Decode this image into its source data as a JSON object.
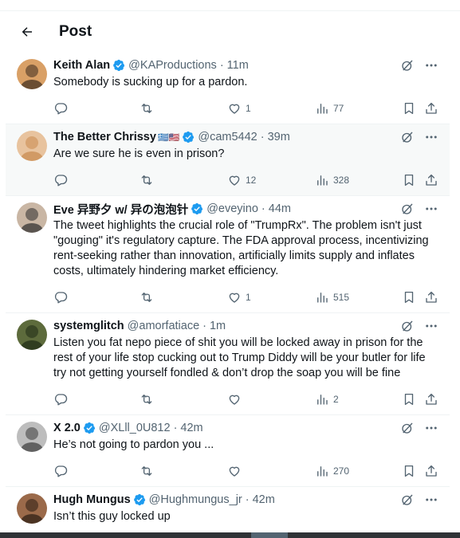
{
  "header": {
    "title": "Post"
  },
  "colors": {
    "verified": "#1d9bf0",
    "text": "#0f1419",
    "muted": "#536471",
    "divider": "#eff3f4"
  },
  "posts": [
    {
      "name": "Keith Alan",
      "verified": true,
      "flags": "",
      "handle": "@KAProductions",
      "time": "11m",
      "text": "Somebody is sucking up for a pardon.",
      "replies": "",
      "reposts": "",
      "likes": "1",
      "views": "77",
      "highlight": false
    },
    {
      "name": "The Better Chrissy",
      "verified": true,
      "flags": "🇬🇷🇺🇸",
      "handle": "@cam5442",
      "time": "39m",
      "text": "Are we sure he is even in prison?",
      "replies": "",
      "reposts": "",
      "likes": "12",
      "views": "328",
      "highlight": true
    },
    {
      "name": "Eve 异野夕 w/ 异の泡泡针",
      "verified": true,
      "flags": "",
      "handle": "@eveyino",
      "time": "44m",
      "text": "The tweet highlights the crucial role of \"TrumpRx\". The problem isn't just \"gouging\" it's regulatory capture. The FDA approval process, incentivizing rent-seeking rather than innovation, artificially limits supply and inflates costs, ultimately hindering market efficiency.",
      "replies": "",
      "reposts": "",
      "likes": "1",
      "views": "515",
      "highlight": false
    },
    {
      "name": "systemglitch",
      "verified": false,
      "flags": "",
      "handle": "@amorfatiace",
      "time": "1m",
      "text": "Listen you fat nepo piece of shit you will be locked away in prison for the rest of your life stop cucking out to Trump Diddy will be your butler for life try not getting yourself fondled & don’t drop the soap you will be fine",
      "replies": "",
      "reposts": "",
      "likes": "",
      "views": "2",
      "highlight": false
    },
    {
      "name": "X 2.0",
      "verified": true,
      "flags": "",
      "handle": "@XLll_0U812",
      "time": "42m",
      "text": "He’s not going to pardon you ...",
      "replies": "",
      "reposts": "",
      "likes": "",
      "views": "270",
      "highlight": false
    },
    {
      "name": "Hugh Mungus",
      "verified": true,
      "flags": "",
      "handle": "@Hughmungus_jr",
      "time": "42m",
      "text": "Isn’t this guy locked up",
      "replies": "",
      "reposts": "",
      "likes": "",
      "views": "",
      "highlight": false
    }
  ]
}
